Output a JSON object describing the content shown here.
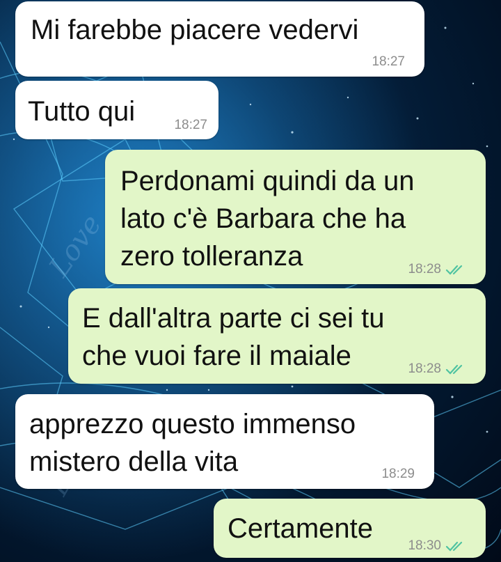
{
  "background": {
    "watermark_text": "Love",
    "watermark_text_2": "Love"
  },
  "colors": {
    "incoming_bubble": "#ffffff",
    "outgoing_bubble": "#e2f6c8",
    "read_ticks": "#4fc3a1",
    "timestamp": "#8c8c8c"
  },
  "messages": [
    {
      "direction": "in",
      "text": "Mi farebbe piacere vedervi",
      "time": "18:27"
    },
    {
      "direction": "in",
      "text": "Tutto qui",
      "time": "18:27"
    },
    {
      "direction": "out",
      "text": "Perdonami quindi da un\nlato c'è Barbara che ha\nzero tolleranza",
      "time": "18:28",
      "status": "read-double-check-icon"
    },
    {
      "direction": "out",
      "text": "E dall'altra parte ci sei tu\nche vuoi fare il maiale",
      "time": "18:28",
      "status": "read-double-check-icon"
    },
    {
      "direction": "in",
      "text": "apprezzo questo immenso\nmistero della vita",
      "time": "18:29"
    },
    {
      "direction": "out",
      "text": "Certamente",
      "time": "18:30",
      "status": "read-double-check-icon"
    }
  ]
}
